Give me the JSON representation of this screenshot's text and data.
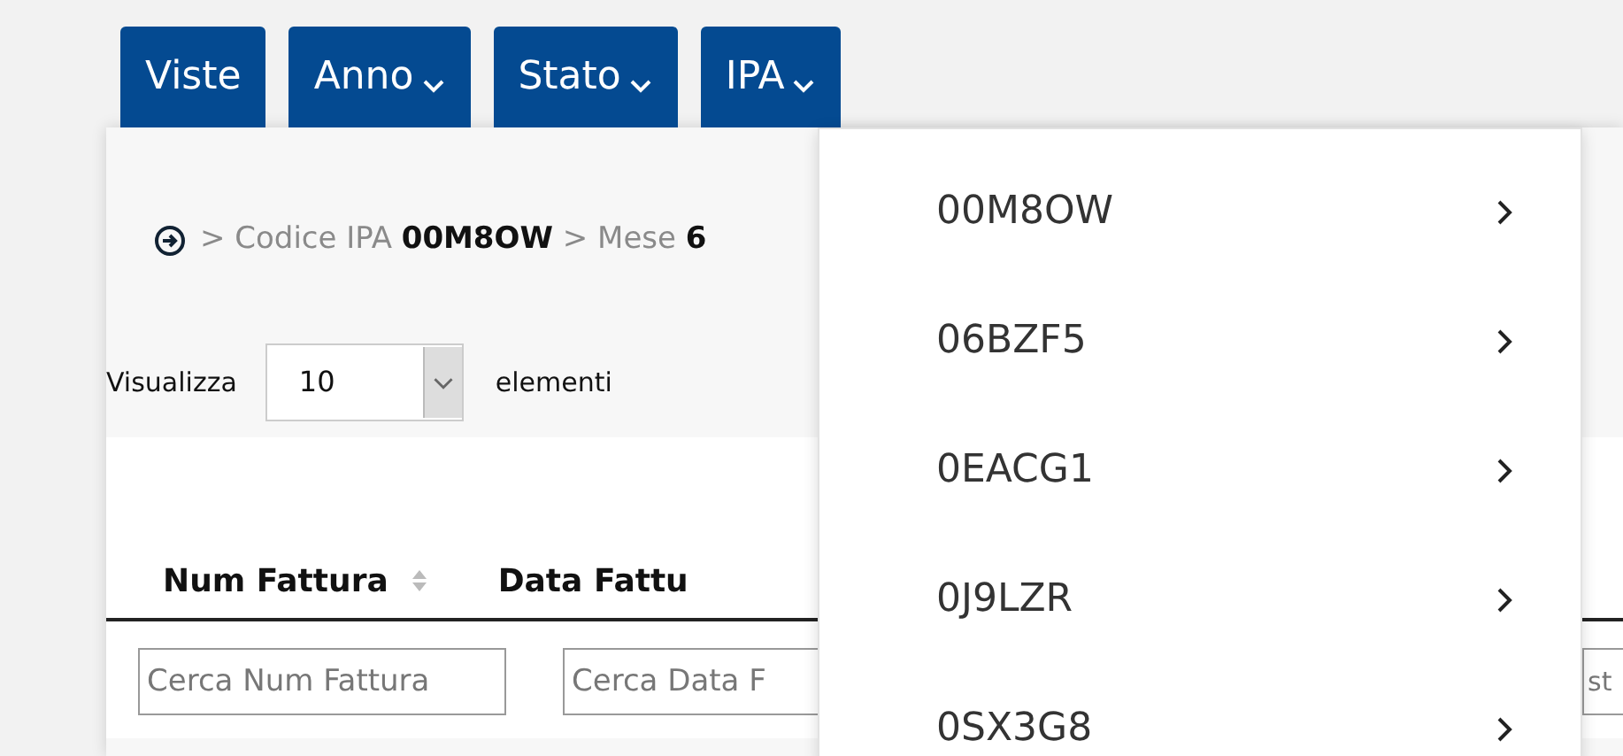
{
  "tabs": [
    {
      "label": "Viste",
      "kind": "plain"
    },
    {
      "label": "Anno",
      "kind": "dropdown"
    },
    {
      "label": "Stato",
      "kind": "dropdown"
    },
    {
      "label": "IPA",
      "kind": "dropdown"
    }
  ],
  "breadcrumb": "> Codice IPA **00M8OW** > Mese **6**",
  "page_length": {
    "label": "Visualizza",
    "value": "10",
    "suffix": "elementi"
  },
  "table": {
    "columns": [
      {
        "label": "Num Fattura",
        "sortable": true
      },
      {
        "label": "Data Fattu",
        "sortable": false
      }
    ],
    "filters": [
      {
        "placeholder": "Cerca Num Fattura"
      },
      {
        "placeholder": "Cerca Data F"
      },
      {
        "placeholder": "st"
      }
    ]
  },
  "dropdown": {
    "items": [
      {
        "label": "00M8OW"
      },
      {
        "label": "06BZF5"
      },
      {
        "label": "0EACG1"
      },
      {
        "label": "0J9LZR"
      },
      {
        "label": "0SX3G8"
      }
    ]
  }
}
